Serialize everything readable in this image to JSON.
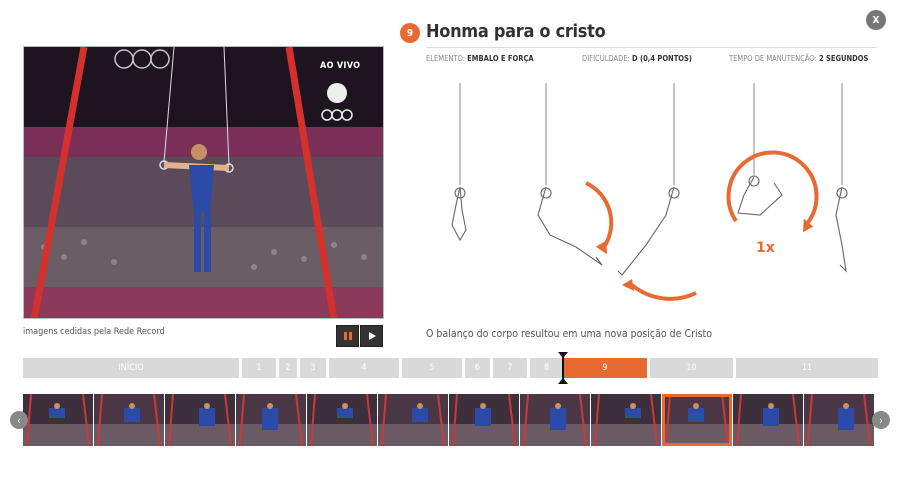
{
  "video": {
    "live_label": "AO VIVO",
    "credit": "imagens cedidas pela Rede Record",
    "pause_icon": "pause-icon",
    "play_icon": "play-icon"
  },
  "element": {
    "step": "9",
    "title": "Honma para o cristo",
    "close_label": "X",
    "meta": [
      {
        "key": "ELEMENTO:",
        "value": "EMBALO E FORÇA"
      },
      {
        "key": "DIFICULDADE:",
        "value": "D (0,4 PONTOS)"
      },
      {
        "key": "TEMPO DE MANUTENÇÃO:",
        "value": "2 SEGUNDOS"
      }
    ],
    "diagram_label": "1x",
    "caption": "O balanço do corpo resultou em uma nova posição de Cristo"
  },
  "timeline": {
    "segments": [
      "INÍCIO",
      "1",
      "2",
      "3",
      "4",
      "5",
      "6",
      "7",
      "8",
      "9",
      "10",
      "11"
    ],
    "active_index": 9
  },
  "thumbnails": {
    "count": 12,
    "selected_index": 9
  },
  "nav": {
    "prev": "‹",
    "next": "›"
  },
  "colors": {
    "accent": "#e86a33",
    "timeline_bg": "#d9d9d9",
    "dark": "#333333"
  }
}
